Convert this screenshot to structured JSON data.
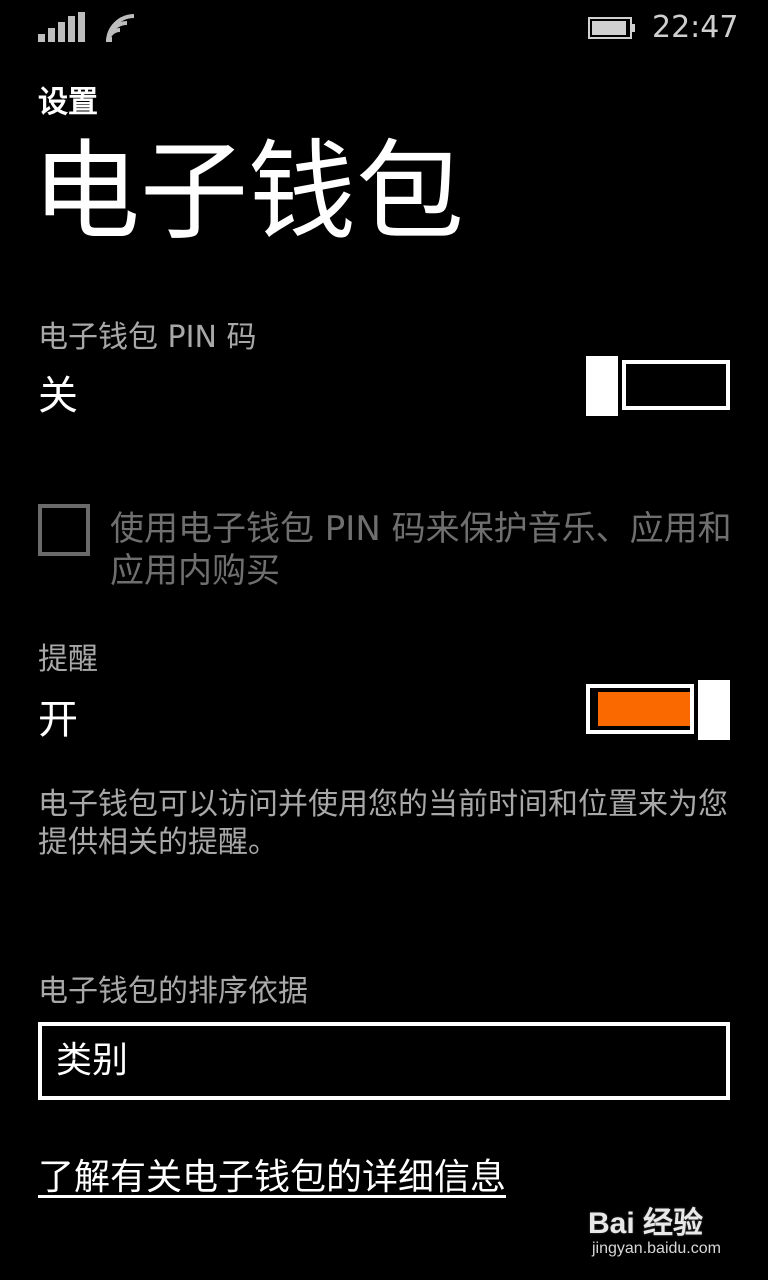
{
  "status_bar": {
    "time": "22:47",
    "signal_icon": "signal-bars-icon",
    "wifi_icon": "wifi-icon",
    "battery_icon": "battery-icon"
  },
  "header": {
    "app_title": "设置",
    "page_title": "电子钱包"
  },
  "pin_setting": {
    "label": "电子钱包 PIN 码",
    "value": "关",
    "enabled": false
  },
  "pin_protect_checkbox": {
    "label": "使用电子钱包 PIN 码来保护音乐、应用和应用内购买",
    "checked": false
  },
  "reminder_setting": {
    "label": "提醒",
    "value": "开",
    "enabled": true,
    "description": "电子钱包可以访问并使用您的当前时间和位置来为您提供相关的提醒。"
  },
  "sort_setting": {
    "label": "电子钱包的排序依据",
    "selected": "类别"
  },
  "learn_more_link": "了解有关电子钱包的详细信息",
  "watermark": {
    "main": "Bai 经验",
    "sub": "jingyan.baidu.com"
  },
  "colors": {
    "background": "#000000",
    "accent": "#fa6800",
    "label_gray": "#a8a8a8",
    "disabled_gray": "#6f6f6f"
  }
}
